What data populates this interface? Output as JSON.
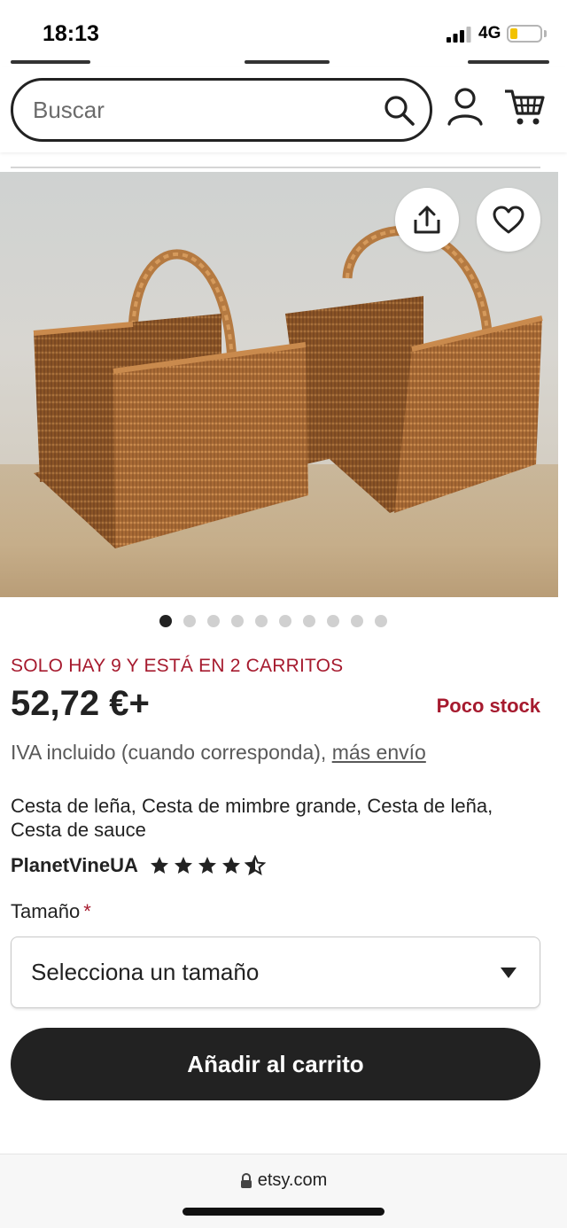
{
  "status_bar": {
    "time": "18:13",
    "network": "4G",
    "battery_level": 0.25,
    "icons": {
      "signal": "signal-bars-icon",
      "battery": "battery-icon"
    }
  },
  "header": {
    "search": {
      "placeholder": "Buscar",
      "value": ""
    },
    "icons": {
      "search": "search-icon",
      "account": "user-icon",
      "cart": "cart-icon"
    }
  },
  "product": {
    "image": {
      "alt_icons": {
        "share": "share-icon",
        "favorite": "heart-icon"
      }
    },
    "carousel": {
      "total": 10,
      "active_index": 0
    },
    "scarcity": "SOLO HAY 9 Y ESTÁ EN 2 CARRITOS",
    "price": "52,72 €+",
    "stock": "Poco stock",
    "vat_text": "IVA incluido (cuando corresponda), ",
    "shipping_link": "más envío",
    "title": "Cesta de leña, Cesta de mimbre grande, Cesta de leña, Cesta de sauce",
    "shop_name": "PlanetVineUA",
    "rating": 4.5,
    "size_label": "Tamaño",
    "required_mark": "*",
    "size_select": {
      "selected": "Selecciona un tamaño"
    },
    "add_to_cart": "Añadir al carrito"
  },
  "browser": {
    "url": "etsy.com",
    "icons": {
      "lock": "lock-icon"
    }
  },
  "colors": {
    "accent_red": "#a61a2e",
    "button_dark": "#222222",
    "battery_yellow": "#f2c200"
  }
}
